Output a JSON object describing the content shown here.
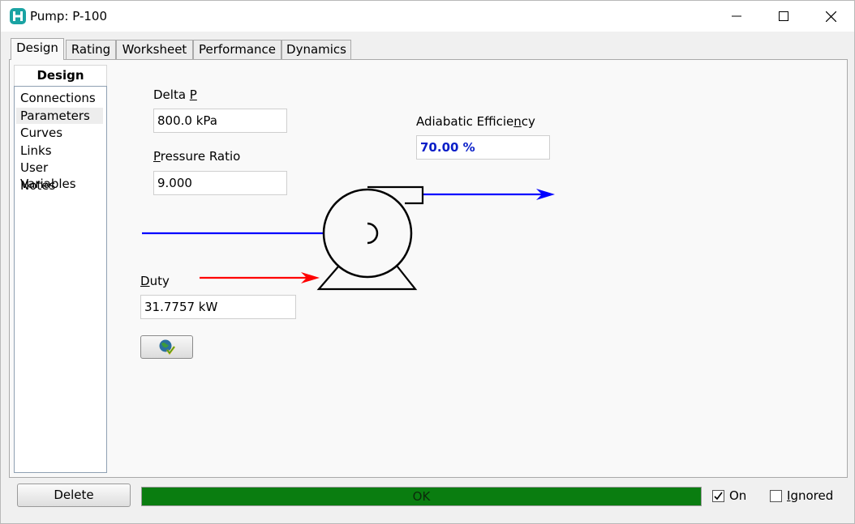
{
  "window": {
    "title": "Pump: P-100",
    "app_icon": "hysys-h-icon"
  },
  "tabs": [
    {
      "label": "Design",
      "active": true
    },
    {
      "label": "Rating",
      "active": false
    },
    {
      "label": "Worksheet",
      "active": false
    },
    {
      "label": "Performance",
      "active": false
    },
    {
      "label": "Dynamics",
      "active": false
    }
  ],
  "nav": {
    "header": "Design",
    "items": [
      {
        "label": "Connections"
      },
      {
        "label": "Parameters",
        "selected": true
      },
      {
        "label": "Curves"
      },
      {
        "label": "Links"
      },
      {
        "label": "User Variables"
      },
      {
        "label": "Notes"
      }
    ]
  },
  "parameters": {
    "delta_p": {
      "label_pre": "Delta ",
      "label_accel": "P",
      "label_post": "",
      "value": "800.0 kPa"
    },
    "pressure_ratio": {
      "label_pre": "",
      "label_accel": "P",
      "label_post": "ressure Ratio",
      "value": "9.000"
    },
    "adiabatic_efficiency": {
      "label_pre": "Adiabatic Efficie",
      "label_accel": "n",
      "label_post": "cy",
      "value": "70.00 %"
    },
    "duty": {
      "label_pre": "",
      "label_accel": "D",
      "label_post": "uty",
      "value": "31.7757 kW"
    }
  },
  "diagram": {
    "inlet_color": "#0000ff",
    "outlet_color": "#0000ff",
    "energy_color": "#ff0000",
    "pump_icon": "centrifugal-pump-icon"
  },
  "footer": {
    "delete_label": "Delete",
    "status_text": "OK",
    "status_color": "#0a7d10",
    "on_label": "On",
    "on_checked": true,
    "ignored_label_accel": "I",
    "ignored_label_post": "gnored",
    "ignored_checked": false
  }
}
